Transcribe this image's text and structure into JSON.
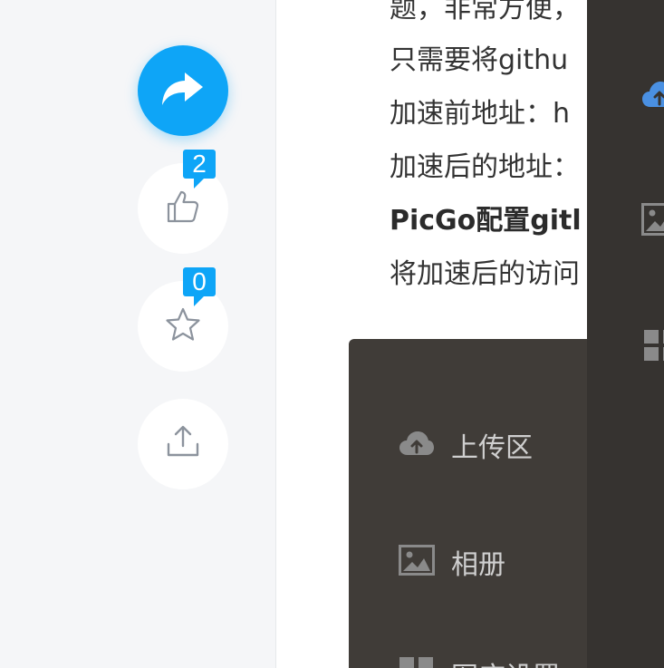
{
  "actions": {
    "share_forward": {
      "icon": "share-forward-icon"
    },
    "like": {
      "icon": "thumbs-up-icon",
      "count": "2"
    },
    "favorite": {
      "icon": "star-icon",
      "count": "0"
    },
    "export": {
      "icon": "upload-share-icon"
    }
  },
  "article": {
    "lines": [
      "题，非常方便，",
      "只需要将githu",
      "加速前地址：h",
      "加速后的地址：",
      "PicGo配置gitl",
      "将加速后的访问"
    ]
  },
  "screenshot_menu": {
    "items": [
      {
        "label": "上传区",
        "icon": "cloud-upload-icon"
      },
      {
        "label": "相册",
        "icon": "image-icon"
      },
      {
        "label": "图床设置",
        "icon": "grid-icon"
      }
    ]
  },
  "side_panel": {
    "icons": [
      "cloud-upload-icon",
      "image-icon",
      "grid-icon"
    ],
    "colors": {
      "cloud": "#4a90e2",
      "icon": "#8a8a8a"
    }
  },
  "colors": {
    "accent": "#0ea5f7",
    "menu_bg": "#403c38",
    "side_bg": "#363330"
  }
}
